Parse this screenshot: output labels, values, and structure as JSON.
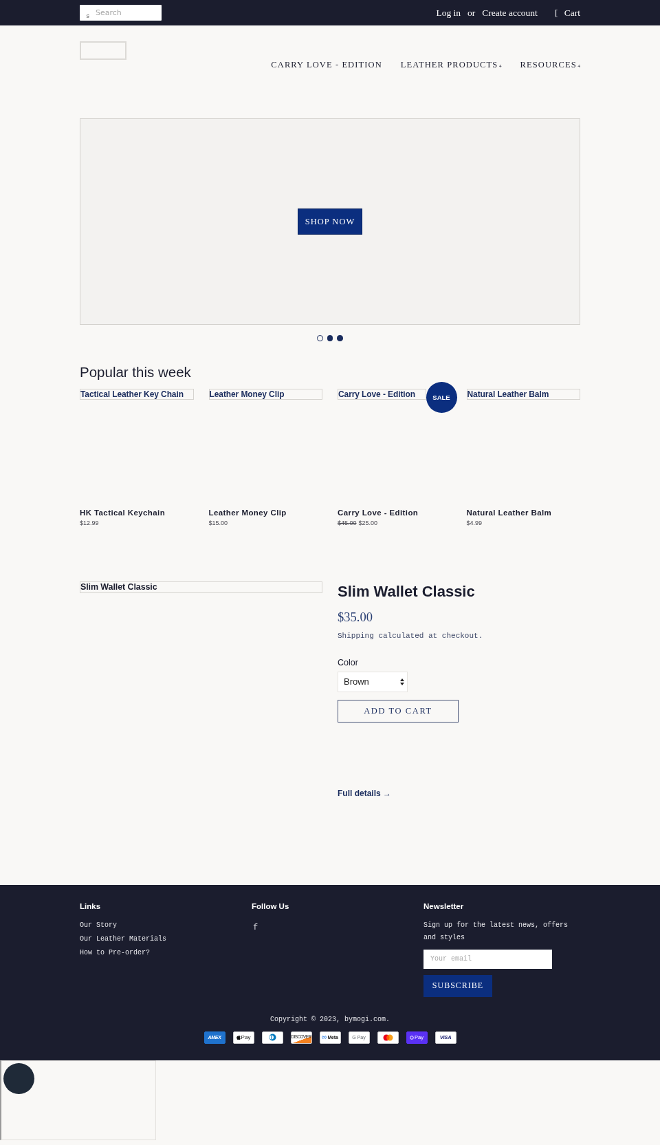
{
  "top_bar": {
    "search": {
      "icon": "s",
      "placeholder": "Search"
    },
    "login": "Log in",
    "separator": "or",
    "create_account": "Create account",
    "cart": {
      "icon": "[",
      "label": "Cart"
    }
  },
  "nav": {
    "items": [
      {
        "label": "CARRY LOVE - EDITION"
      },
      {
        "label": "LEATHER PRODUCTS",
        "caret": "4"
      },
      {
        "label": "RESOURCES",
        "caret": "4"
      }
    ]
  },
  "slideshow": {
    "button": "SHOP NOW",
    "dots": [
      {
        "selected": true
      },
      {
        "selected": false
      },
      {
        "selected": false
      }
    ]
  },
  "featured_collection": {
    "title": "Popular this week",
    "products": [
      {
        "image_alt": "Tactical Leather Key Chain",
        "title": "HK Tactical Keychain",
        "price": "$12.99"
      },
      {
        "image_alt": "Leather Money Clip",
        "title": "Leather Money Clip",
        "price": "$15.00"
      },
      {
        "image_alt": "Carry Love - Edition",
        "title": "Carry Love - Edition",
        "compare_price": "$45.00",
        "price": "$25.00",
        "badge": "SALE"
      },
      {
        "image_alt": "Natural Leather Balm",
        "title": "Natural Leather Balm",
        "price": "$4.99"
      }
    ]
  },
  "featured_product": {
    "image_alt": "Slim Wallet Classic",
    "title": "Slim Wallet Classic",
    "price": "$35.00",
    "shipping_note": "Shipping calculated at checkout.",
    "option": {
      "label": "Color",
      "value": "Brown"
    },
    "add_to_cart": "ADD TO CART",
    "details_link": {
      "label": "Full details",
      "icon": "→"
    }
  },
  "footer": {
    "columns": [
      {
        "kind": "links",
        "title": "Links",
        "items": [
          "Our Story",
          "Our Leather Materials",
          "How to Pre-order?"
        ]
      },
      {
        "kind": "social",
        "title": "Follow Us",
        "icons": [
          "f"
        ]
      },
      {
        "kind": "newsletter",
        "title": "Newsletter",
        "text": "Sign up for the latest news, offers and styles",
        "placeholder": "Your email",
        "button": "SUBSCRIBE"
      }
    ],
    "copyright": "Copyright © 2023, bymogi.com.",
    "payment_icons": [
      {
        "kind": "amex",
        "label": "AMEX"
      },
      {
        "kind": "apple_pay",
        "label": "Pay"
      },
      {
        "kind": "diners"
      },
      {
        "kind": "discover",
        "label": "DISCOVER"
      },
      {
        "kind": "meta_pay",
        "label": "Meta"
      },
      {
        "kind": "google_pay",
        "label": "G Pay"
      },
      {
        "kind": "mastercard"
      },
      {
        "kind": "shop_pay",
        "label": "Pay"
      },
      {
        "kind": "visa",
        "label": "VISA"
      }
    ]
  }
}
